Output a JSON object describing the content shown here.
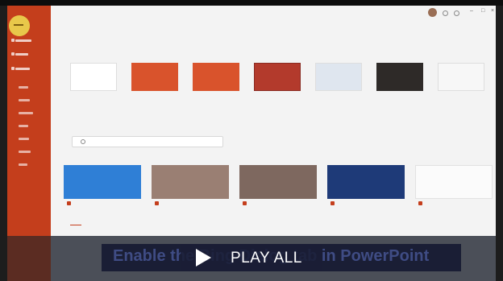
{
  "overlay": {
    "play_label": "PLAY ALL",
    "subtitle": "Enable the Bing Dialog tab in PowerPoint"
  },
  "colors": {
    "accent": "#c43e1c",
    "back_button": "#e8c84a",
    "overlay_bg": "#1a1e35",
    "play_text": "#ffffff"
  },
  "icons": [
    "play-icon",
    "back-arrow-icon",
    "search-icon",
    "settings-icon",
    "help-icon",
    "minimize-icon",
    "maximize-icon",
    "close-icon"
  ]
}
